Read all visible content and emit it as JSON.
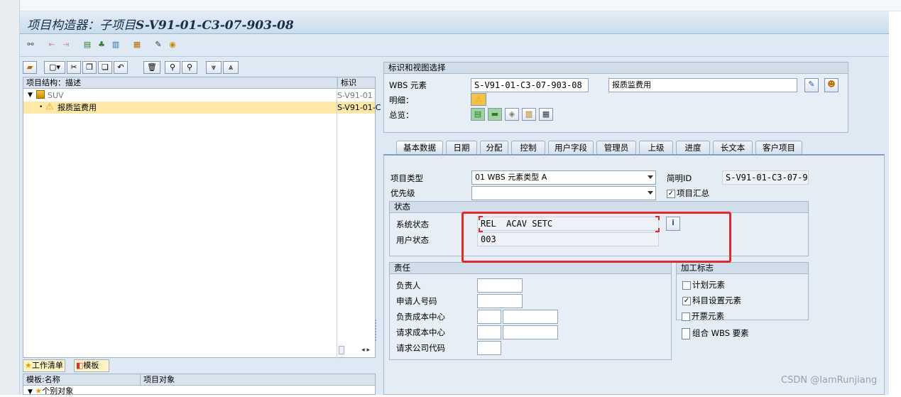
{
  "window": {
    "title_prefix": "项目构造器：子项目",
    "title_id": "S-V91-01-C3-07-903-08"
  },
  "tree": {
    "col_desc": "项目结构：描述",
    "col_id": "标识",
    "rows": [
      {
        "label": "SUV",
        "id": "S-V91-01"
      },
      {
        "label": "报质监费用",
        "id": "S-V91-01-C"
      }
    ]
  },
  "bottom_panel": {
    "tab_worklist": "工作清单",
    "tab_template": "模板",
    "col_name": "模板:名称",
    "col_object": "项目对象",
    "row_label": "个别对象"
  },
  "id_section": {
    "title": "标识和视图选择",
    "wbs_label": "WBS 元素",
    "wbs_value": "S-V91-01-C3-07-903-08",
    "wbs_desc": "报质监费用",
    "detail_label": "明细：",
    "overview_label": "总览："
  },
  "tabs": [
    "基本数据",
    "日期",
    "分配",
    "控制",
    "用户字段",
    "管理员",
    "上级",
    "进度",
    "长文本",
    "客户项目"
  ],
  "basic": {
    "project_type_label": "项目类型",
    "project_type_value": "01 WBS 元素类型 A",
    "priority_label": "优先级",
    "priority_value": "",
    "short_id_label": "简明ID",
    "short_id_value": "S-V91-01-C3-07-9",
    "summary_label": "项目汇总",
    "status_group": "状态",
    "system_status_label": "系统状态",
    "system_status_value": "REL  ACAV SETC",
    "user_status_label": "用户状态",
    "user_status_value": "003",
    "resp_group": "责任",
    "responsible_label": "负责人",
    "applicant_label": "申请人号码",
    "resp_cc_label": "负责成本中心",
    "req_cc_label": "请求成本中心",
    "req_company_label": "请求公司代码",
    "flags_group": "加工标志",
    "flag_plan": "计划元素",
    "flag_acct": "科目设置元素",
    "flag_bill": "开票元素",
    "group_wbs": "组合 WBS 要素"
  },
  "watermark": "CSDN @IamRunjiang",
  "colors": {
    "highlight_row": "#fde8a6",
    "annotation_red": "#e0282e",
    "title_text": "#1b2e4a"
  }
}
